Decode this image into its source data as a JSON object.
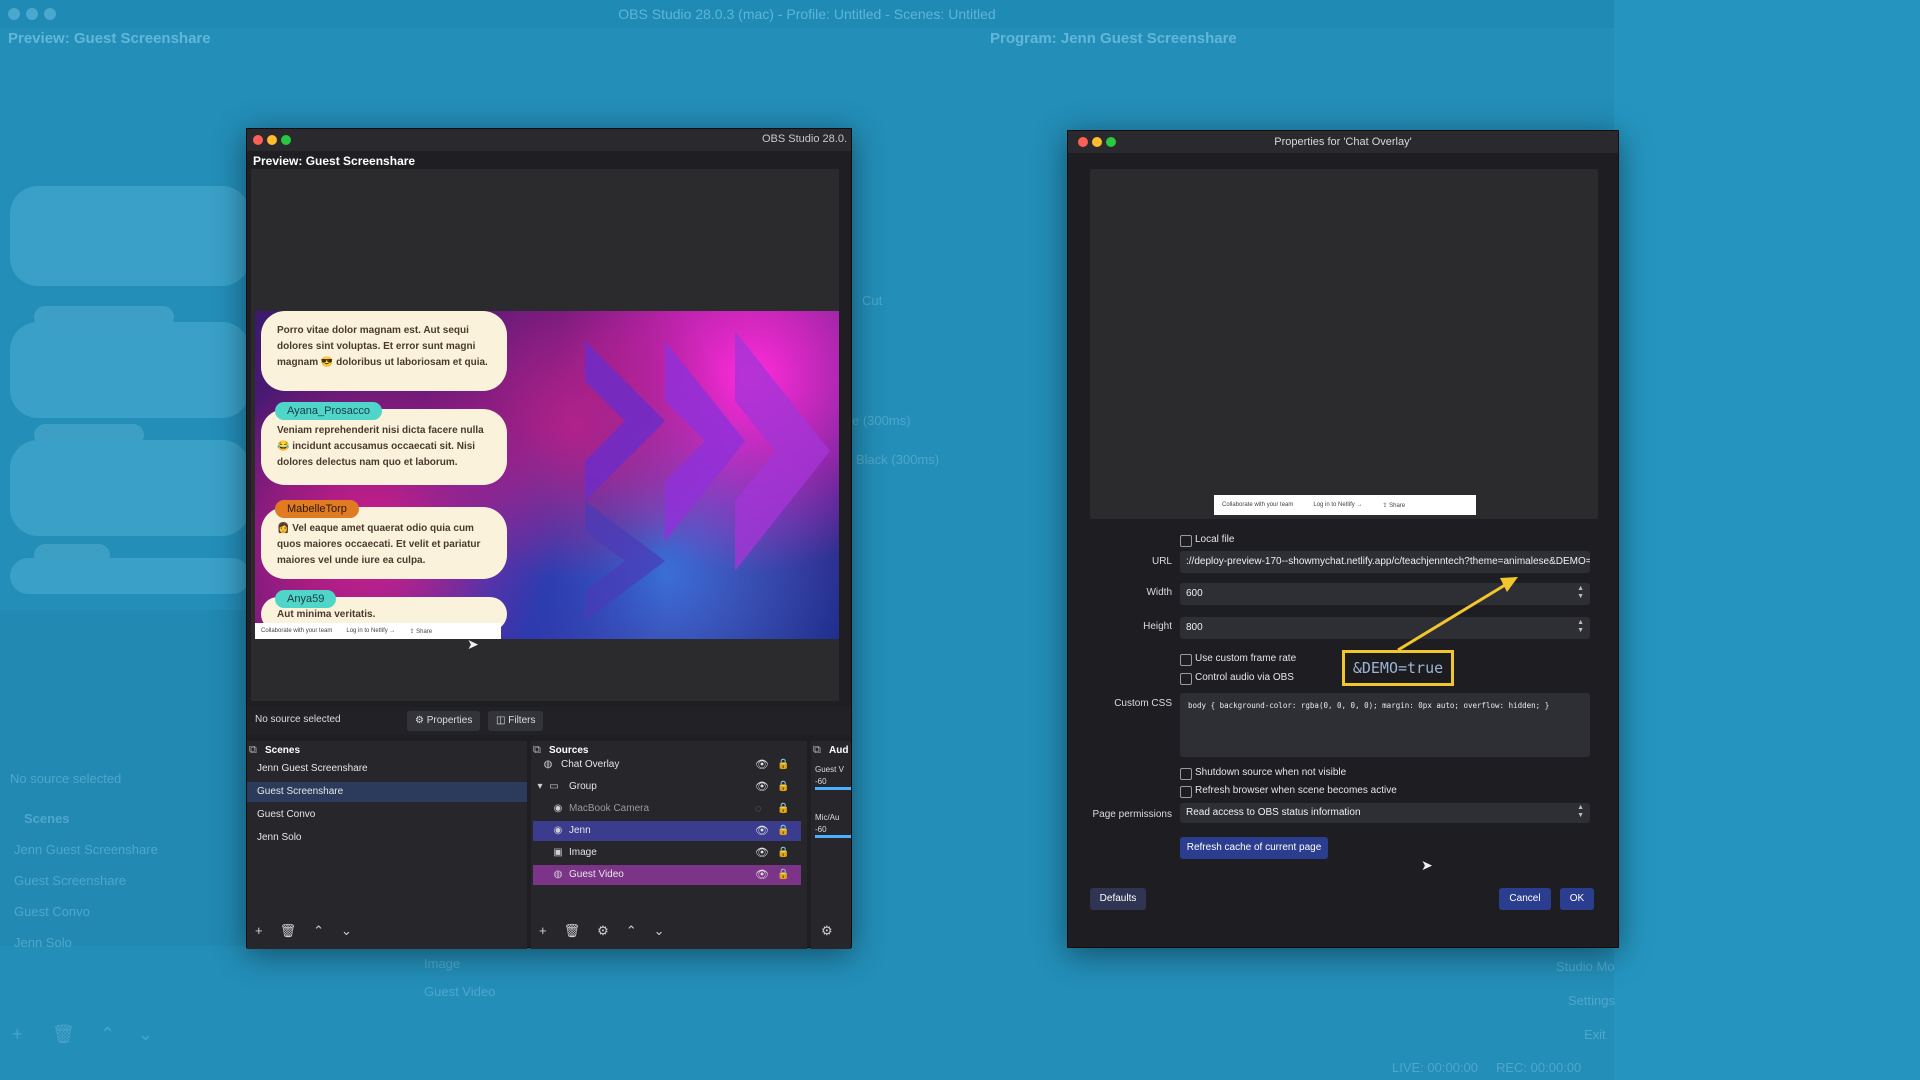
{
  "background": {
    "window_title": "OBS Studio 28.0.3 (mac) - Profile: Untitled - Scenes: Untitled",
    "preview_label": "Preview: Guest Screenshare",
    "program_label": "Program: Jenn Guest Screenshare",
    "no_source": "No source selected",
    "scenes_header": "Scenes",
    "scenes": [
      "Jenn Guest Screenshare",
      "Guest Screenshare",
      "Guest Convo",
      "Jenn Solo"
    ],
    "sources": [
      "Image",
      "Guest Video"
    ],
    "transitions": [
      "Cut",
      "e (300ms)",
      "Black (300ms)"
    ],
    "status_live": "LIVE: 00:00:00",
    "status_rec": "REC: 00:00:00",
    "right_items": [
      "Studio Mo",
      "Settings",
      "Exit"
    ]
  },
  "obs": {
    "title": "OBS Studio 28.0.",
    "preview_label": "Preview: Guest Screenshare",
    "chat": [
      {
        "user": "",
        "text": "Porro vitae dolor magnam est. Aut sequi dolores sint voluptas. Et error sunt magni magnam 😎 doloribus ut laboriosam et quia."
      },
      {
        "user": "Ayana_Prosacco",
        "text": "😂 incidunt accusamus occaecati sit. Nisi dolores delectus nam quo et laborum.",
        "lead": "Veniam reprehenderit nisi dicta facere nulla"
      },
      {
        "user": "MabelleTorp",
        "text": "👩 Vel eaque amet quaerat odio quia cum quos maiores occaecati. Et velit et pariatur maiores vel unde iure ea culpa."
      },
      {
        "user": "Anya59",
        "text": "Aut minima veritatis."
      }
    ],
    "footer": {
      "collab": "Collaborate with your team",
      "login": "Log in to Netlify →",
      "share": "⇪ Share"
    },
    "no_source": "No source selected",
    "properties_btn": "Properties",
    "filters_btn": "Filters",
    "scenes_header": "Scenes",
    "scenes": [
      "Jenn Guest Screenshare",
      "Guest Screenshare",
      "Guest Convo",
      "Jenn Solo"
    ],
    "selected_scene": "Guest Screenshare",
    "sources_header": "Sources",
    "sources": [
      {
        "name": "Chat Overlay",
        "icon": "globe-icon"
      },
      {
        "name": "Group",
        "icon": "folder-icon"
      },
      {
        "name": "MacBook Camera",
        "icon": "camera-icon"
      },
      {
        "name": "Jenn",
        "icon": "camera-icon"
      },
      {
        "name": "Image",
        "icon": "image-icon"
      },
      {
        "name": "Guest Video",
        "icon": "globe-icon"
      }
    ],
    "audio_header": "Aud",
    "audio": [
      {
        "name": "Guest V",
        "level": "-60"
      },
      {
        "name": "Mic/Au",
        "level": "-60"
      }
    ]
  },
  "props": {
    "title": "Properties for 'Chat Overlay'",
    "footer": {
      "collab": "Collaborate with your team",
      "login": "Log in to Netlify →",
      "share": "⇪ Share"
    },
    "local_file": "Local file",
    "url_label": "URL",
    "url_value": "://deploy-preview-170--showmychat.netlify.app/c/teachjenntech?theme=animalese&DEMO=true",
    "width_label": "Width",
    "width_value": "600",
    "height_label": "Height",
    "height_value": "800",
    "custom_fps": "Use custom frame rate",
    "control_audio": "Control audio via OBS",
    "css_label": "Custom CSS",
    "css_value": "body { background-color: rgba(0, 0, 0, 0); margin: 0px auto; overflow: hidden; }",
    "shutdown": "Shutdown source when not visible",
    "refresh_active": "Refresh browser when scene becomes active",
    "permissions_label": "Page permissions",
    "permissions_value": "Read access to OBS status information",
    "refresh_cache": "Refresh cache of current page",
    "defaults": "Defaults",
    "cancel": "Cancel",
    "ok": "OK"
  },
  "annotation": "&DEMO=true",
  "colors": {
    "accent_yellow": "#f2c62d",
    "chip_teal": "#4fd6c9",
    "chip_orange": "#e07b22",
    "chat_bubble": "#fbf2dc"
  }
}
